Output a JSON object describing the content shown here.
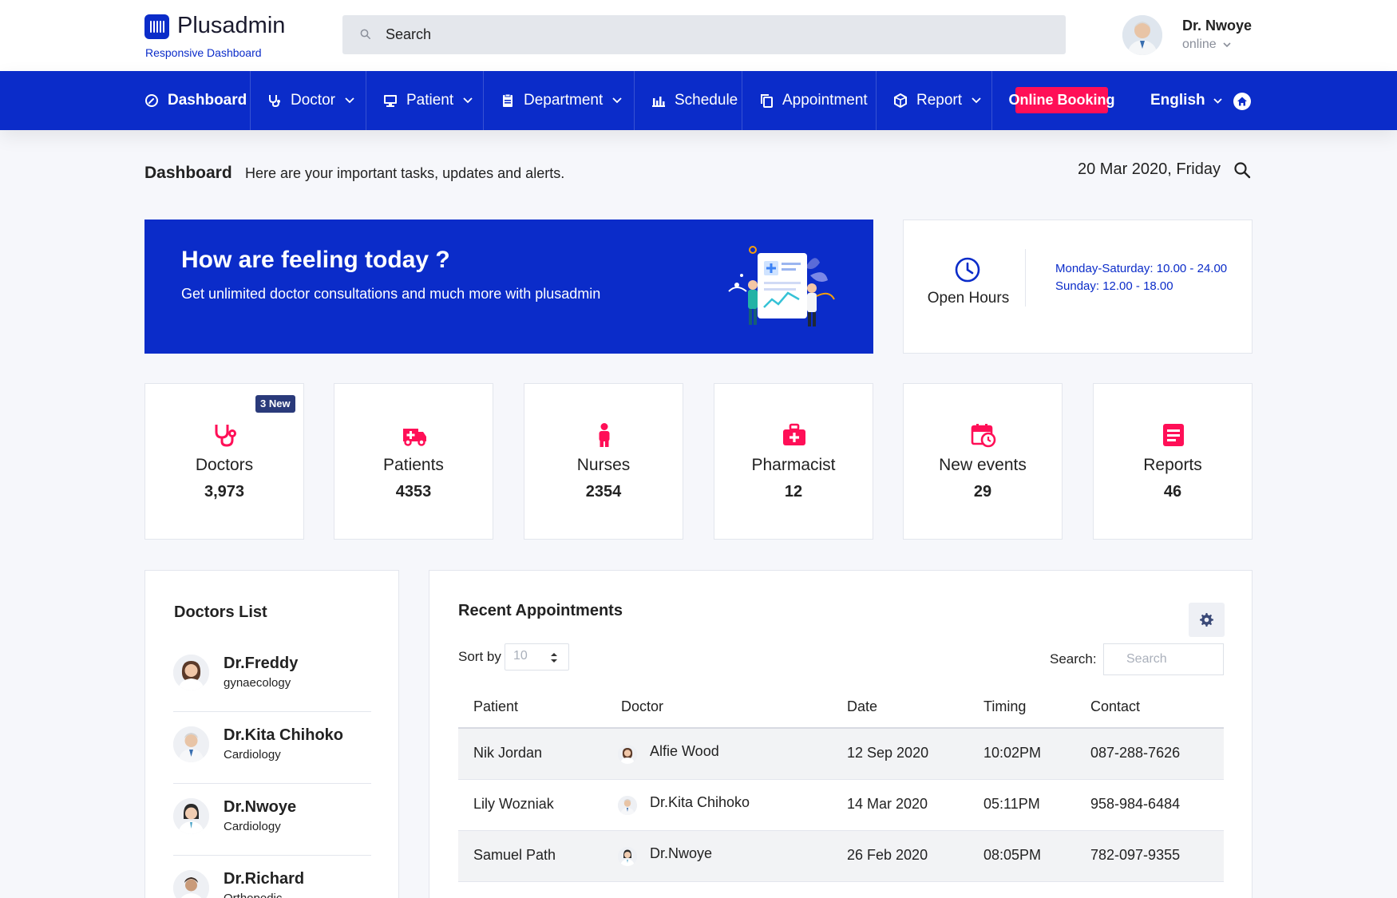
{
  "brand": {
    "name": "Plusadmin",
    "tagline": "Responsive Dashboard"
  },
  "search": {
    "placeholder": "Search"
  },
  "user": {
    "name": "Dr. Nwoye",
    "status": "online"
  },
  "nav": {
    "items": [
      {
        "label": "Dashboard",
        "icon": "dashboard-icon"
      },
      {
        "label": "Doctor",
        "icon": "stethoscope-icon"
      },
      {
        "label": "Patient",
        "icon": "monitor-icon"
      },
      {
        "label": "Department",
        "icon": "clipboard-icon"
      },
      {
        "label": "Schedule",
        "icon": "bar-chart-icon"
      },
      {
        "label": "Appointment",
        "icon": "copy-icon"
      },
      {
        "label": "Report",
        "icon": "box-icon"
      }
    ],
    "booking_label": "Online Booking",
    "language": "English"
  },
  "page": {
    "title": "Dashboard",
    "subtitle": "Here are your important tasks, updates and alerts.",
    "date": "20 Mar 2020, Friday"
  },
  "hero": {
    "title": "How are feeling today ?",
    "subtitle": "Get unlimited doctor consultations and much more with plusadmin"
  },
  "hours": {
    "label": "Open Hours",
    "weekday": "Monday-Saturday: 10.00 - 24.00",
    "sunday": "Sunday: 12.00 - 18.00"
  },
  "stats": [
    {
      "label": "Doctors",
      "value": "3,973",
      "badge": "3 New",
      "icon": "stethoscope-icon"
    },
    {
      "label": "Patients",
      "value": "4353",
      "icon": "ambulance-icon"
    },
    {
      "label": "Nurses",
      "value": "2354",
      "icon": "person-icon"
    },
    {
      "label": "Pharmacist",
      "value": "12",
      "icon": "medical-bag-icon"
    },
    {
      "label": "New events",
      "value": "29",
      "icon": "calendar-clock-icon"
    },
    {
      "label": "Reports",
      "value": "46",
      "icon": "report-icon"
    }
  ],
  "doctors_list": {
    "title": "Doctors List",
    "items": [
      {
        "name": "Dr.Freddy",
        "specialty": "gynaecology"
      },
      {
        "name": "Dr.Kita Chihoko",
        "specialty": "Cardiology"
      },
      {
        "name": "Dr.Nwoye",
        "specialty": "Cardiology"
      },
      {
        "name": "Dr.Richard",
        "specialty": "Orthopedic"
      }
    ]
  },
  "appointments": {
    "title": "Recent Appointments",
    "sort_label": "Sort by",
    "sort_value": "10",
    "search_label": "Search:",
    "search_placeholder": "Search",
    "columns": [
      "Patient",
      "Doctor",
      "Date",
      "Timing",
      "Contact"
    ],
    "rows": [
      {
        "patient": "Nik Jordan",
        "doctor": "Alfie Wood",
        "date": "12 Sep 2020",
        "timing": "10:02PM",
        "contact": "087-288-7626"
      },
      {
        "patient": "Lily Wozniak",
        "doctor": "Dr.Kita Chihoko",
        "date": "14 Mar 2020",
        "timing": "05:11PM",
        "contact": "958-984-6484"
      },
      {
        "patient": "Samuel Path",
        "doctor": "Dr.Nwoye",
        "date": "26 Feb 2020",
        "timing": "08:05PM",
        "contact": "782-097-9355"
      }
    ]
  },
  "colors": {
    "primary": "#0b2cc9",
    "accent": "#ff0f57",
    "background": "#f6f7fb"
  }
}
